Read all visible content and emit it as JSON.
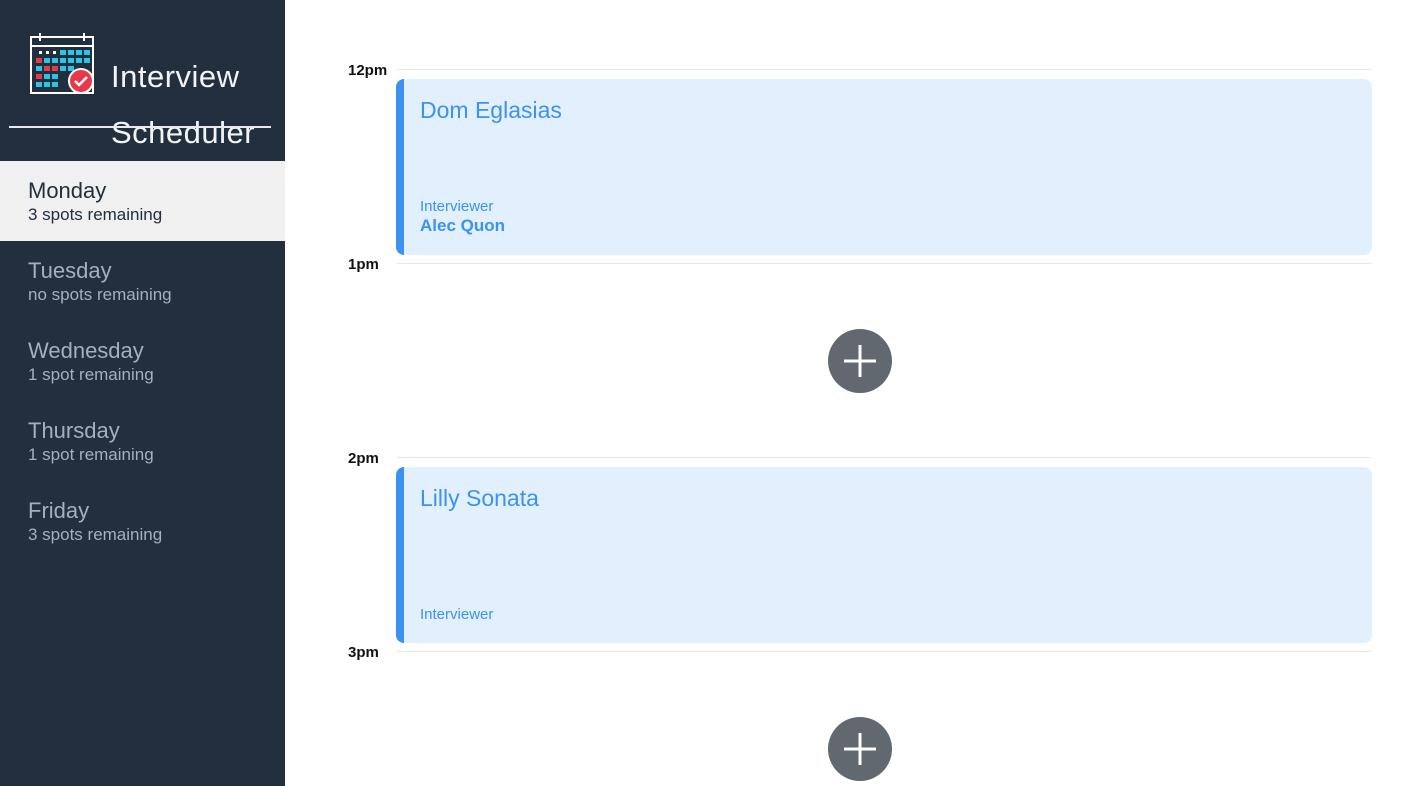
{
  "app": {
    "title_line1": "Interview",
    "title_line2": "Scheduler",
    "logo_icon": "calendar-check-icon"
  },
  "days": [
    {
      "name": "Monday",
      "spots": "3 spots remaining",
      "selected": true
    },
    {
      "name": "Tuesday",
      "spots": "no spots remaining",
      "selected": false
    },
    {
      "name": "Wednesday",
      "spots": "1 spot remaining",
      "selected": false
    },
    {
      "name": "Thursday",
      "spots": "1 spot remaining",
      "selected": false
    },
    {
      "name": "Friday",
      "spots": "3 spots remaining",
      "selected": false
    }
  ],
  "schedule": {
    "times": [
      "12pm",
      "1pm",
      "2pm",
      "3pm"
    ],
    "appointments": [
      {
        "student": "Dom Eglasias",
        "interviewer_label": "Interviewer",
        "interviewer": "Alec Quon"
      },
      {
        "student": "Lilly Sonata",
        "interviewer_label": "Interviewer",
        "interviewer": ""
      }
    ],
    "add_icon": "plus-icon"
  },
  "colors": {
    "sidebar_bg": "#222f3e",
    "selected_day_bg": "#f0f0f0",
    "appointment_bg": "#e2effd",
    "accent": "#3b92f2",
    "add_button": "#61686f"
  }
}
